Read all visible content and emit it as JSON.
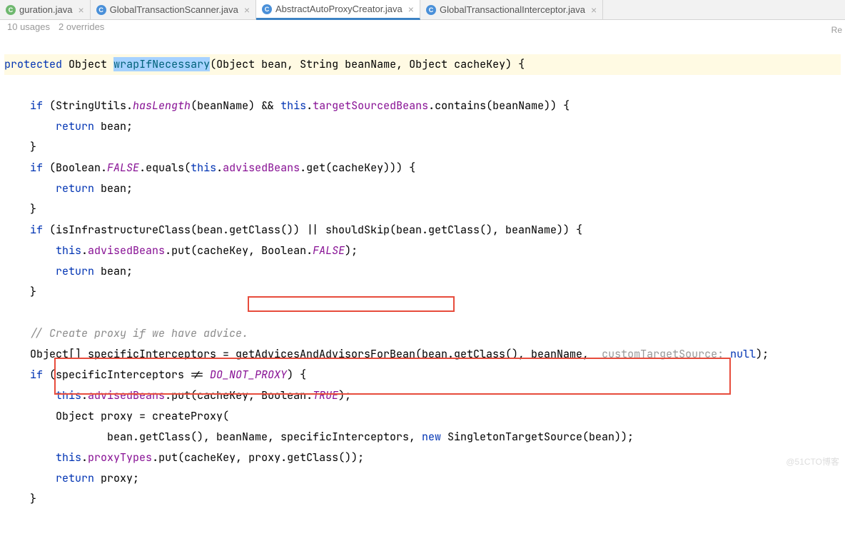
{
  "tabs": [
    {
      "label": "guration.java",
      "active": false,
      "iconColor": "green"
    },
    {
      "label": "GlobalTransactionScanner.java",
      "active": false,
      "iconColor": "blue"
    },
    {
      "label": "AbstractAutoProxyCreator.java",
      "active": true,
      "iconColor": "blue"
    },
    {
      "label": "GlobalTransactionalInterceptor.java",
      "active": false,
      "iconColor": "blue"
    }
  ],
  "meta": {
    "usages": "10 usages",
    "overrides": "2 overrides"
  },
  "code": {
    "sig": {
      "protected": "protected",
      "object": "Object",
      "method": "wrapIfNecessary",
      "params": "(Object bean, String beanName, Object cacheKey) {"
    },
    "l1a": "if",
    "l1b": " (StringUtils.",
    "l1c": "hasLength",
    "l1d": "(beanName) && ",
    "l1e": "this",
    "l1f": ".",
    "l1g": "targetSourcedBeans",
    "l1h": ".contains(beanName)) {",
    "ret": "return",
    "bean": " bean;",
    "close": "}",
    "l2a": "if",
    "l2b": " (Boolean.",
    "l2c": "FALSE",
    "l2d": ".equals(",
    "l2e": "this",
    "l2f": ".",
    "l2g": "advisedBeans",
    "l2h": ".get(cacheKey))) {",
    "l3a": "if",
    "l3b": " (isInfrastructureClass(bean.getClass()) || shouldSkip(bean.getClass(), beanName)) {",
    "l3c": "this",
    "l3d": ".",
    "l3e": "advisedBeans",
    "l3f": ".put(cacheKey, Boolean.",
    "l3g": "FALSE",
    "l3h": ");",
    "comment": "// Create proxy if we have advice.",
    "l4a": "Object[] specificInterceptors = ",
    "l4b": "getAdvicesAndAdvisorsForBean",
    "l4c": "(bean.getClass(), beanName, ",
    "l4hint": "customTargetSource:",
    "l4d": " null",
    "l4e": ");",
    "l5a": "if",
    "l5b": " (specificInterceptors != ",
    "l5c": "DO_NOT_PROXY",
    "l5d": ") {",
    "l6a": "this",
    "l6b": ".",
    "l6c": "advisedBeans",
    "l6d": ".put(cacheKey, Boolean.",
    "l6e": "TRUE",
    "l6f": ");",
    "l7a": "Object proxy = createProxy(",
    "l8a": "bean.getClass(), beanName, specificInterceptors, ",
    "l8b": "new",
    "l8c": " SingletonTargetSource(bean));",
    "l9a": "this",
    "l9b": ".",
    "l9c": "proxyTypes",
    "l9d": ".put(cacheKey, proxy.getClass());",
    "l10a": "return",
    "l10b": " proxy;"
  },
  "gutterHint": "Re",
  "watermark": "@51CTO博客"
}
